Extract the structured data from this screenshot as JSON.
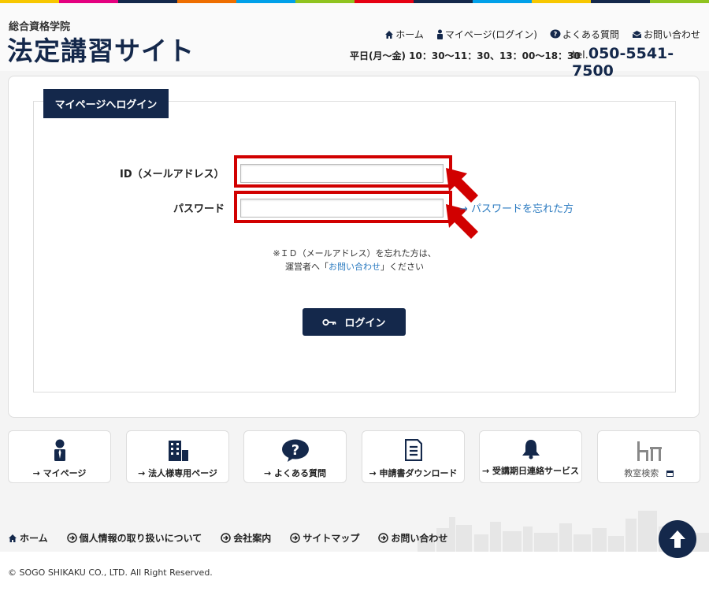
{
  "colors": {
    "navy": "#14284b",
    "link": "#2a7ac0",
    "highlight": "#d10000",
    "rainbow": [
      "#f7c700",
      "#e4007f",
      "#14284b",
      "#ee6e00",
      "#00a0e9",
      "#8fc31f",
      "#e60012",
      "#14284b",
      "#00a0e9",
      "#f7c700",
      "#14284b",
      "#8fc31f"
    ]
  },
  "header": {
    "logo_sub": "総合資格学院",
    "logo_main": "法定講習サイト",
    "nav": [
      {
        "label": "ホーム",
        "icon": "home-icon"
      },
      {
        "label": "マイページ(ログイン)",
        "icon": "person-icon"
      },
      {
        "label": "よくある質問",
        "icon": "question-icon"
      },
      {
        "label": "お問い合わせ",
        "icon": "mail-icon"
      }
    ],
    "hours": "平日(月〜金) 10：30〜11：30、13：00〜18：30",
    "tel_label": "tel.",
    "tel_number": "050-5541-7500"
  },
  "login": {
    "tab_title": "マイページへログイン",
    "id_label": "ID（メールアドレス）",
    "id_value": "",
    "password_label": "パスワード",
    "password_value": "",
    "forgot_password": "→ パスワードを忘れた方",
    "note_line1": "※ＩＤ（メールアドレス）を忘れた方は、",
    "note_line2_pre": "運営者へ「",
    "note_link": "お問い合わせ",
    "note_line2_post": "」ください",
    "button_label": "ログイン"
  },
  "cards": [
    {
      "label": "→ マイページ",
      "icon": "person-icon"
    },
    {
      "label": "→ 法人様専用ページ",
      "icon": "building-icon"
    },
    {
      "label": "→ よくある質問",
      "icon": "question-icon"
    },
    {
      "label": "→ 申請書ダウンロード",
      "icon": "document-icon"
    },
    {
      "label": "→ 受講期日連絡サービス",
      "icon": "bell-icon"
    },
    {
      "label": "教室検索",
      "icon": "desk-icon"
    }
  ],
  "footer": {
    "nav": [
      {
        "label": "ホーム",
        "icon": "home-icon"
      },
      {
        "label": "個人情報の取り扱いについて",
        "icon": "arrow-circle-icon"
      },
      {
        "label": "会社案内",
        "icon": "arrow-circle-icon"
      },
      {
        "label": "サイトマップ",
        "icon": "arrow-circle-icon"
      },
      {
        "label": "お問い合わせ",
        "icon": "arrow-circle-icon"
      }
    ],
    "copyright": "© SOGO SHIKAKU CO., LTD. All Right Reserved."
  }
}
